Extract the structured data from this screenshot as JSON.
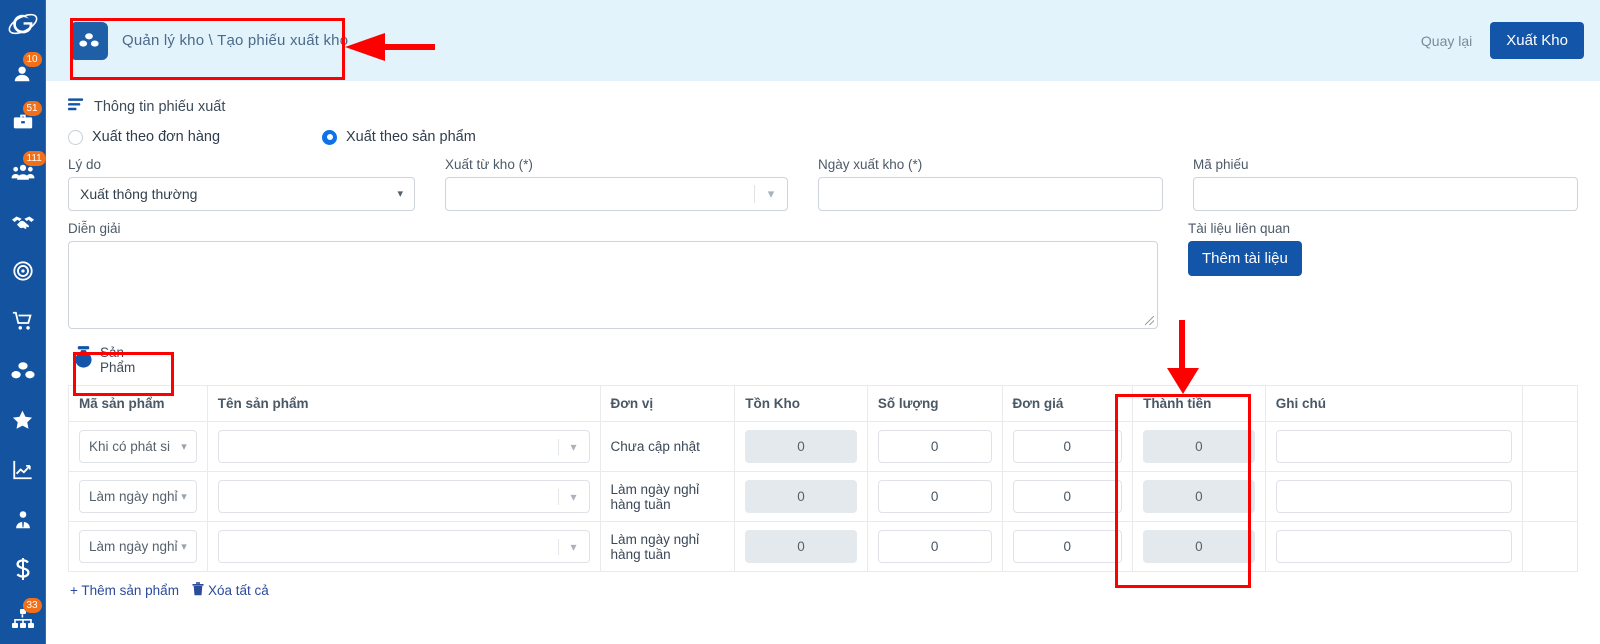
{
  "sidebar": {
    "logo": "orbit-logo",
    "items": [
      {
        "icon": "user-icon",
        "badge": "10"
      },
      {
        "icon": "briefcase-icon",
        "badge": "51"
      },
      {
        "icon": "meeting-icon",
        "badge": "111"
      },
      {
        "icon": "handshake-icon",
        "badge": ""
      },
      {
        "icon": "target-icon",
        "badge": ""
      },
      {
        "icon": "cart-icon",
        "badge": ""
      },
      {
        "icon": "boxes-icon",
        "badge": ""
      },
      {
        "icon": "star-icon",
        "badge": ""
      },
      {
        "icon": "chart-icon",
        "badge": ""
      },
      {
        "icon": "person-tie-icon",
        "badge": ""
      },
      {
        "icon": "dollar-icon",
        "badge": ""
      },
      {
        "icon": "sitemap-icon",
        "badge": "33"
      }
    ]
  },
  "topbar": {
    "breadcrumb_icon": "boxes-icon",
    "breadcrumb": "Quản lý kho \\  Tạo phiếu xuất kho",
    "back_link": "Quay lại",
    "submit_button": "Xuất Kho"
  },
  "info_section": {
    "icon": "list-lines-icon",
    "title": "Thông tin phiếu xuất",
    "radios": [
      {
        "label": "Xuất theo đơn hàng",
        "selected": false
      },
      {
        "label": "Xuất theo sản phẩm",
        "selected": true
      }
    ],
    "fields": {
      "reason": {
        "label": "Lý do",
        "value": "Xuất thông thường",
        "placeholder": ""
      },
      "from_warehouse": {
        "label": "Xuất từ kho (*)",
        "value": "",
        "placeholder": ""
      },
      "export_date": {
        "label": "Ngày xuất kho (*)",
        "value": "",
        "placeholder": ""
      },
      "voucher_code": {
        "label": "Mã phiếu",
        "value": "",
        "placeholder": ""
      },
      "description": {
        "label": "Diễn giải",
        "value": "",
        "placeholder": ""
      },
      "related_docs": {
        "label": "Tài liệu liên quan",
        "button": "Thêm tài liệu"
      }
    }
  },
  "product_section": {
    "icon": "bag-icon",
    "title": "Sản Phẩm",
    "columns": [
      "Mã sản phẩm",
      "Tên sản phẩm",
      "Đơn vị",
      "Tồn Kho",
      "Số lượng",
      "Đơn giá",
      "Thành tiền",
      "Ghi chú",
      ""
    ],
    "rows": [
      {
        "product_code": "Khi có phát si",
        "product_name": "",
        "unit": "Chưa cập nhật",
        "stock": "0",
        "quantity": "0",
        "unit_price": "0",
        "amount": "0",
        "note": ""
      },
      {
        "product_code": "Làm ngày nghỉ",
        "product_name": "",
        "unit": "Làm ngày nghỉ hàng tuần",
        "stock": "0",
        "quantity": "0",
        "unit_price": "0",
        "amount": "0",
        "note": ""
      },
      {
        "product_code": "Làm ngày nghỉ",
        "product_name": "",
        "unit": "Làm ngày nghỉ hàng tuần",
        "stock": "0",
        "quantity": "0",
        "unit_price": "0",
        "amount": "0",
        "note": ""
      }
    ],
    "actions": {
      "add_product": "+ Thêm sản phẩm",
      "delete_all": "Xóa tất cả",
      "delete_icon": "trash-icon"
    }
  },
  "colors": {
    "sidebar": "#14539f",
    "topbar": "#e3f3fb",
    "primary": "#1355a8",
    "badge": "#f2701a",
    "annotation": "#fd0000",
    "radio_on": "#0e71e8"
  }
}
